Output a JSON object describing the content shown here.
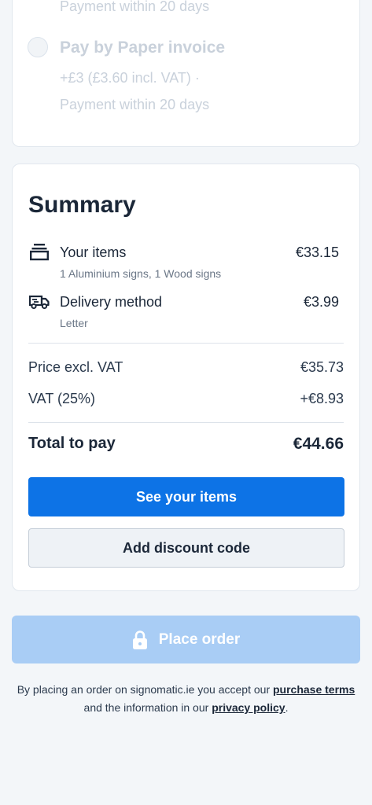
{
  "payment": {
    "previous_terms": "Payment within 20 days",
    "option_title": "Pay by Paper invoice",
    "option_price": "+£3 (£3.60 incl. VAT) ·",
    "option_terms": "Payment within 20 days"
  },
  "summary": {
    "title": "Summary",
    "items": {
      "icon": "stack-icon",
      "label": "Your items",
      "sub": "1 Aluminium signs, 1 Wood signs",
      "amount": "€33.15"
    },
    "delivery": {
      "icon": "truck-icon",
      "label": "Delivery method",
      "sub": "Letter",
      "amount": "€3.99"
    },
    "price_excl_vat_label": "Price excl. VAT",
    "price_excl_vat_value": "€35.73",
    "vat_label": "VAT (25%)",
    "vat_value": "+€8.93",
    "total_label": "Total to pay",
    "total_value": "€44.66",
    "see_items_button": "See your items",
    "discount_button": "Add discount code"
  },
  "place_order": {
    "label": "Place order",
    "icon": "lock-icon"
  },
  "terms": {
    "prefix": "By placing an order on signomatic.ie you accept our",
    "purchase_terms_link": "purchase terms",
    "middle": "and the information in our",
    "privacy_policy_link": "privacy policy",
    "suffix": "."
  },
  "colors": {
    "primary": "#0d73e6",
    "disabled_primary": "#a9cdf5",
    "background": "#f3f6f9"
  }
}
